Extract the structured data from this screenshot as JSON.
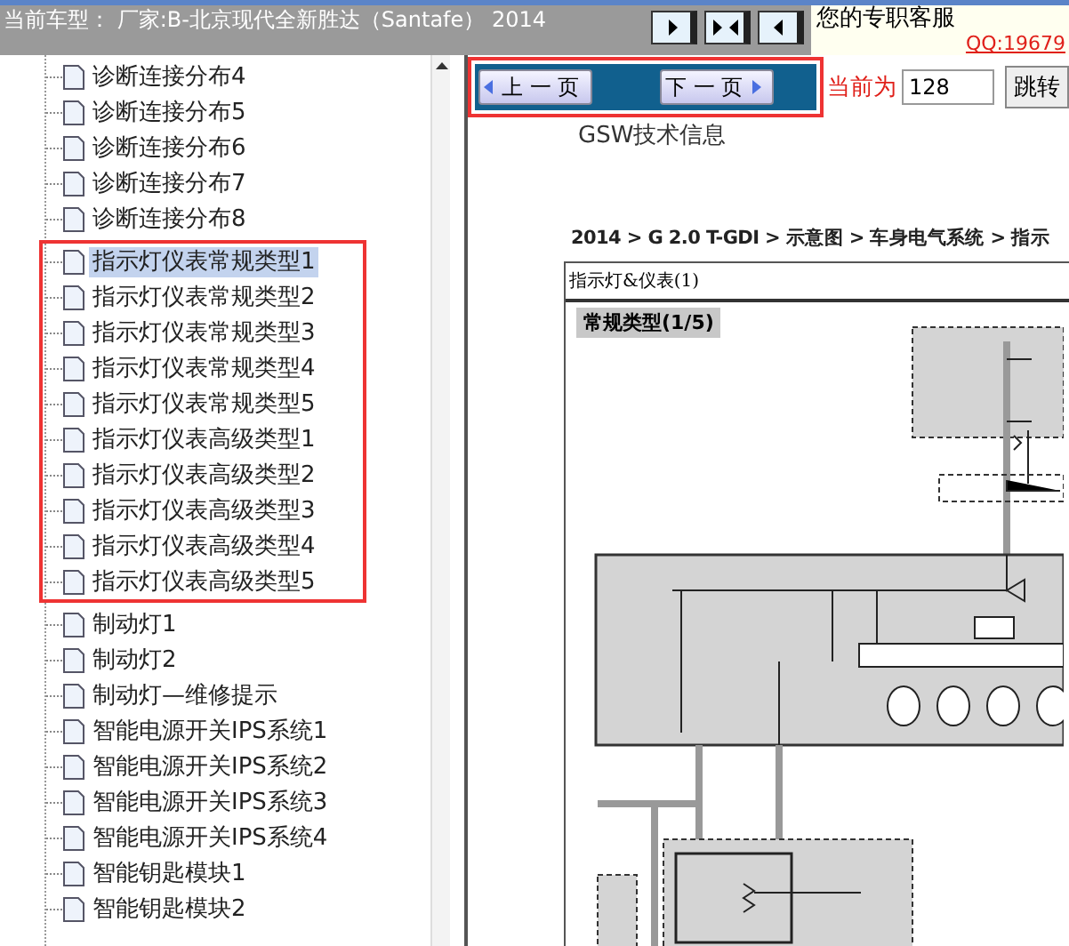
{
  "header": {
    "title": "当前车型： 厂家:B-北京现代全新胜达（Santafe） 2014"
  },
  "support": {
    "label": "您的专职客服",
    "link": "QQ:19679"
  },
  "tree": {
    "groups": [
      {
        "highlighted": false,
        "items": [
          {
            "label": "诊断连接分布4",
            "selected": false
          },
          {
            "label": "诊断连接分布5",
            "selected": false
          },
          {
            "label": "诊断连接分布6",
            "selected": false
          },
          {
            "label": "诊断连接分布7",
            "selected": false
          },
          {
            "label": "诊断连接分布8",
            "selected": false
          }
        ]
      },
      {
        "highlighted": true,
        "items": [
          {
            "label": "指示灯仪表常规类型1",
            "selected": true
          },
          {
            "label": "指示灯仪表常规类型2",
            "selected": false
          },
          {
            "label": "指示灯仪表常规类型3",
            "selected": false
          },
          {
            "label": "指示灯仪表常规类型4",
            "selected": false
          },
          {
            "label": "指示灯仪表常规类型5",
            "selected": false
          },
          {
            "label": "指示灯仪表高级类型1",
            "selected": false
          },
          {
            "label": "指示灯仪表高级类型2",
            "selected": false
          },
          {
            "label": "指示灯仪表高级类型3",
            "selected": false
          },
          {
            "label": "指示灯仪表高级类型4",
            "selected": false
          },
          {
            "label": "指示灯仪表高级类型5",
            "selected": false
          }
        ]
      },
      {
        "highlighted": false,
        "items": [
          {
            "label": "制动灯1",
            "selected": false
          },
          {
            "label": "制动灯2",
            "selected": false
          },
          {
            "label": "制动灯—维修提示",
            "selected": false
          },
          {
            "label": "智能电源开关IPS系统1",
            "selected": false
          },
          {
            "label": "智能电源开关IPS系统2",
            "selected": false
          },
          {
            "label": "智能电源开关IPS系统3",
            "selected": false
          },
          {
            "label": "智能电源开关IPS系统4",
            "selected": false
          },
          {
            "label": "智能钥匙模块1",
            "selected": false
          },
          {
            "label": "智能钥匙模块2",
            "selected": false
          }
        ]
      }
    ]
  },
  "pager": {
    "highlighted": true,
    "prev": "上 一 页",
    "next": "下 一 页",
    "current_label": "当前为",
    "current_value": "128",
    "jump": "跳转"
  },
  "document": {
    "heading": "GSW技术信息",
    "breadcrumb": "2014 > G 2.0 T-GDI > 示意图 > 车身电气系统 > 指示",
    "section_title": "指示灯&仪表(1)",
    "subtitle": "常规类型(1/5)"
  }
}
